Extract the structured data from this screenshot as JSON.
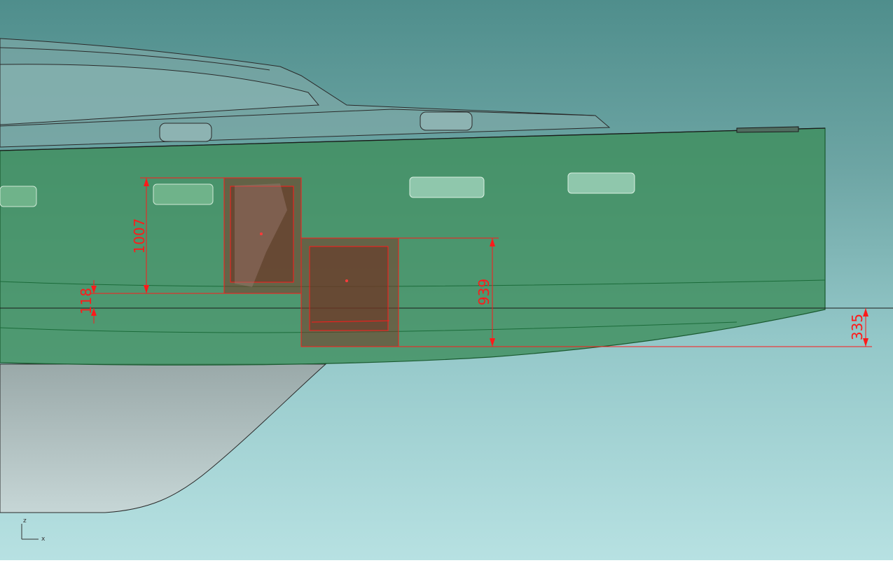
{
  "viewport": {
    "colors": {
      "bg_top": "#4f8e8c",
      "bg_bottom": "#b7e1e2",
      "hull": "#3f8f5e",
      "keel": "#9fb2b2",
      "cabin": "#7aa6a5",
      "dimension": "#ff1a1a",
      "hatch_fill": "#7a3b28"
    }
  },
  "dimensions": {
    "height_left": "1007",
    "offset_left": "118",
    "height_right": "939",
    "offset_bow": "335"
  },
  "axis": {
    "z_label": "z",
    "x_label": "x"
  }
}
